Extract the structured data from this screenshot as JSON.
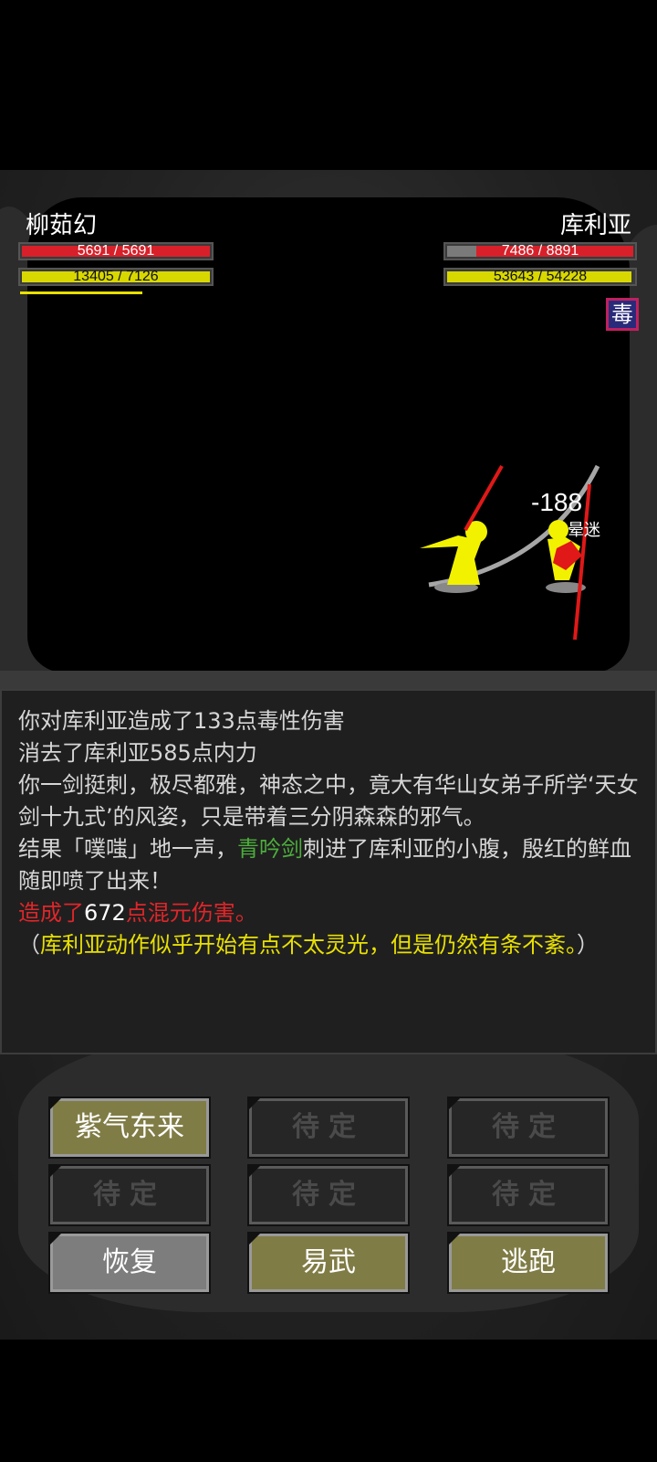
{
  "player": {
    "name": "柳茹幻",
    "hp_text": "5691 / 5691",
    "hp_fraction": 1.0,
    "mp_text": "13405 / 7126",
    "mp_fraction": 1.0
  },
  "enemy": {
    "name": "库利亚",
    "hp_text": "7486 / 8891",
    "hp_fraction": 0.842,
    "mp_text": "53643 / 54228",
    "mp_fraction": 0.989,
    "status_icon": "毒"
  },
  "effects": {
    "damage_number": "-188",
    "status_text": "晕迷"
  },
  "log": {
    "lines": [
      {
        "segments": [
          {
            "text": "你对库利亚造成了133点毒性伤害",
            "color": "#d6d6d6"
          }
        ]
      },
      {
        "segments": [
          {
            "text": "消去了库利亚585点内力",
            "color": "#d6d6d6"
          }
        ]
      },
      {
        "segments": [
          {
            "text": "你一剑挺刺，极尽都雅，神态之中，竟大有华山女弟子所学‘天女剑十九式’的风姿，只是带着三分阴森森的邪气。",
            "color": "#d6d6d6"
          }
        ]
      },
      {
        "segments": [
          {
            "text": "结果「噗嗤」地一声，",
            "color": "#d6d6d6"
          },
          {
            "text": "青吟剑",
            "color": "#4cae3c"
          },
          {
            "text": "刺进了库利亚的小腹，殷红的鲜血随即喷了出来！",
            "color": "#d6d6d6"
          }
        ]
      },
      {
        "segments": [
          {
            "text": "造成了",
            "color": "#e0262a"
          },
          {
            "text": "672",
            "color": "#ffffff"
          },
          {
            "text": "点混元伤害。",
            "color": "#e0262a"
          }
        ]
      },
      {
        "segments": [
          {
            "text": "（",
            "color": "#d6d6d6"
          },
          {
            "text": "库利亚动作似乎开始有点不太灵光，但是仍然有条不紊。",
            "color": "#e8e000"
          },
          {
            "text": "）",
            "color": "#d6d6d6"
          }
        ]
      }
    ]
  },
  "buttons": {
    "skill1": "紫气东来",
    "skill2": "待定",
    "skill3": "待定",
    "skill4": "待定",
    "skill5": "待定",
    "skill6": "待定",
    "restore": "恢复",
    "switch_weapon": "易武",
    "flee": "逃跑"
  },
  "colors": {
    "hp": "#d8202a",
    "mp": "#d8d800",
    "enemy_hp_lost": "#7a7a7a",
    "active_button": "#807c46"
  }
}
